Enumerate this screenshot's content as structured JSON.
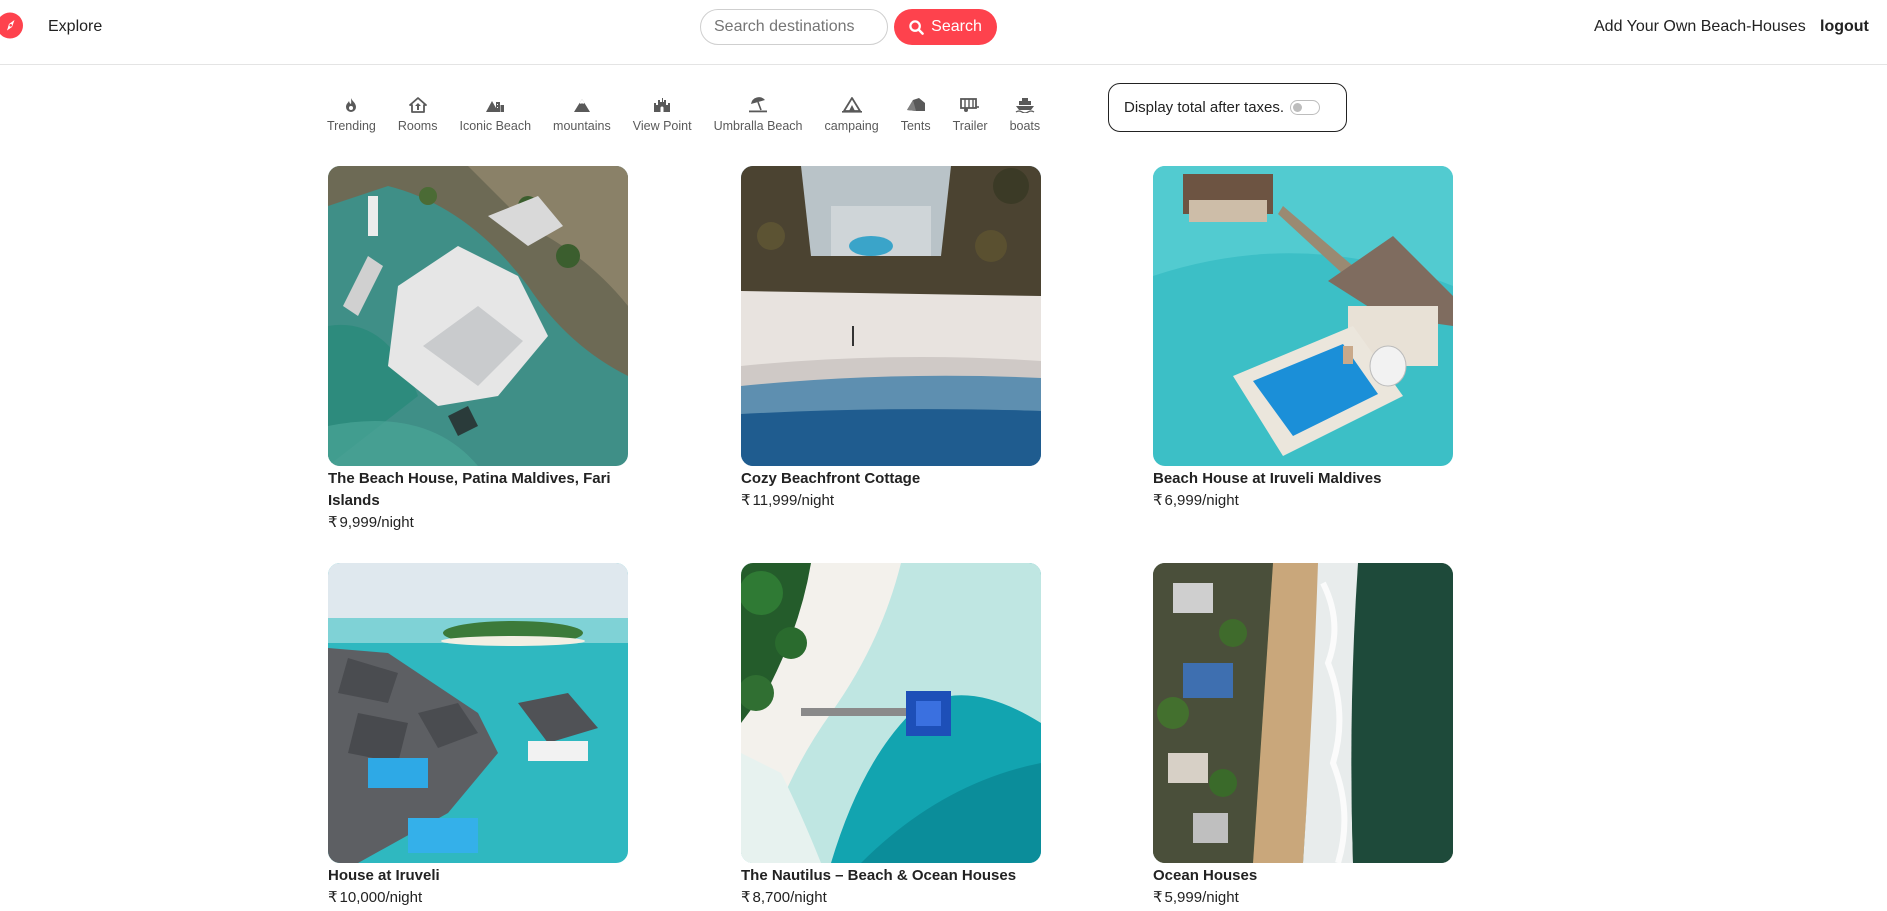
{
  "navbar": {
    "explore_label": "Explore",
    "search_placeholder": "Search destinations",
    "search_button_label": "Search",
    "add_listing_label": "Add Your Own Beach-Houses",
    "logout_label": "logout",
    "brand_color": "#fe424d"
  },
  "filters": [
    {
      "label": "Trending",
      "icon": "fire-icon"
    },
    {
      "label": "Rooms",
      "icon": "home-icon"
    },
    {
      "label": "Iconic Beach",
      "icon": "mountain-city-icon"
    },
    {
      "label": "mountains",
      "icon": "mountain-icon"
    },
    {
      "label": "View Point",
      "icon": "castle-icon"
    },
    {
      "label": "Umbralla Beach",
      "icon": "umbrella-beach-icon"
    },
    {
      "label": "campaing",
      "icon": "campground-icon"
    },
    {
      "label": "Tents",
      "icon": "tent-icon"
    },
    {
      "label": "Trailer",
      "icon": "trailer-icon"
    },
    {
      "label": "boats",
      "icon": "ship-icon"
    }
  ],
  "tax_toggle": {
    "label": "Display total after taxes.",
    "enabled": false
  },
  "listings": [
    {
      "title": "The Beach House, Patina Maldives, Fari Islands",
      "currency": "₹",
      "price": "9,999",
      "unit": "/night"
    },
    {
      "title": "Cozy Beachfront Cottage",
      "currency": "₹",
      "price": "11,999",
      "unit": "/night"
    },
    {
      "title": "Beach House at Iruveli Maldives",
      "currency": "₹",
      "price": "6,999",
      "unit": "/night"
    },
    {
      "title": "House at Iruveli",
      "currency": "₹",
      "price": "10,000",
      "unit": "/night"
    },
    {
      "title": "The Nautilus – Beach & Ocean Houses",
      "currency": "₹",
      "price": "8,700",
      "unit": "/night"
    },
    {
      "title": "Ocean Houses",
      "currency": "₹",
      "price": "5,999",
      "unit": "/night"
    }
  ]
}
